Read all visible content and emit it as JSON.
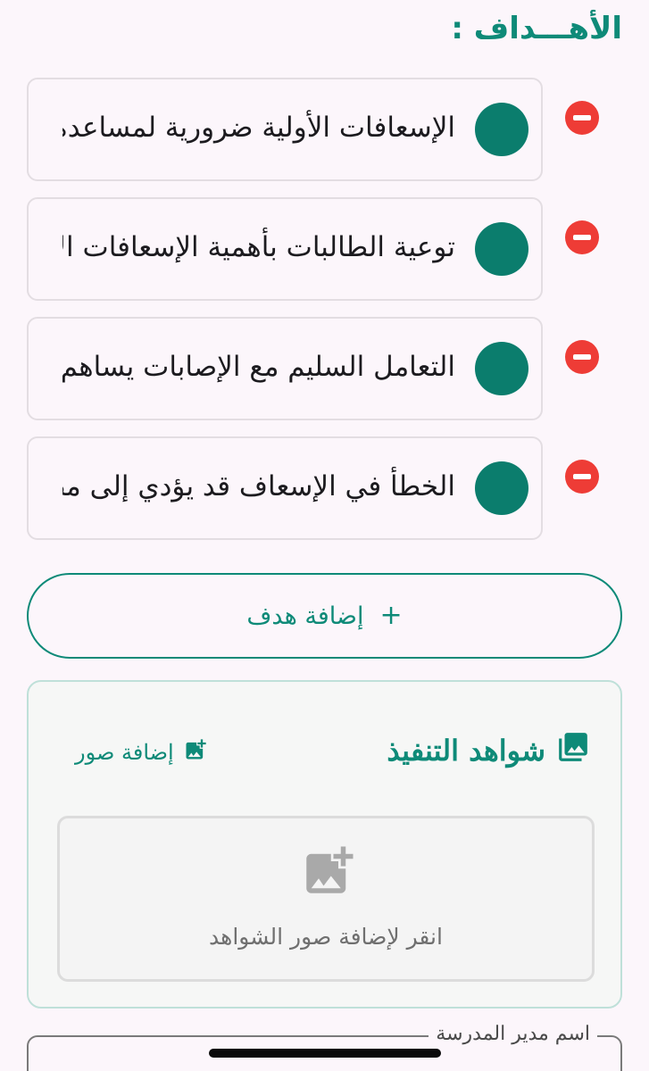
{
  "goals_section": {
    "title": "الأهـــداف :"
  },
  "goals": [
    {
      "text": "الإسعافات الأولية ضرورية لمساعدة المصاب والتعامل مع الحالة المناسب لها قبل وصول الفرق الطبية."
    },
    {
      "text": "توعية الطالبات بأهمية الإسعافات الأولية وتشجيعهن على اكتساب هذه المهارة الحيوية."
    },
    {
      "text": "التعامل السليم مع الإصابات يساهم في الحد من الآثار طويلة الأمد للإصابة."
    },
    {
      "text": "الخطأ في الإسعاف قد يؤدي إلى مضاعفات أو عجز دائم للمصاب."
    }
  ],
  "add_goal": {
    "label": "إضافة هدف",
    "plus": "+"
  },
  "evidence": {
    "title": "شواهد التنفيذ",
    "add_images_label": "إضافة صور",
    "dropzone_text": "انقر لإضافة صور الشواهد",
    "icons": {
      "title": "photo-library-icon",
      "add": "add-photo-icon",
      "dropzone": "add-photo-large-icon"
    }
  },
  "principal_field": {
    "label": "اسم مدير المدرسة",
    "value": ""
  },
  "colors": {
    "accent": "#0e8a78",
    "dot": "#0b7d6d",
    "remove": "#ee3c36",
    "background": "#fcf6fb"
  }
}
